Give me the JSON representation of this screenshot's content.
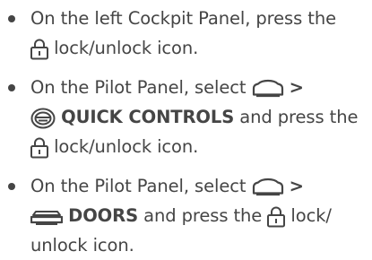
{
  "steps": [
    {
      "text_a": "On the left Cockpit Panel, press the",
      "text_b": "lock/unlock icon.",
      "icons": [
        "lock-icon"
      ]
    },
    {
      "text_a": "On the Pilot Panel, select",
      "text_b": ">",
      "text_c": "QUICK CONTROLS",
      "text_d": "and press the",
      "text_e": "lock/unlock icon.",
      "icons": [
        "car-icon",
        "steering-wheel-icon",
        "lock-icon"
      ]
    },
    {
      "text_a": "On the Pilot Panel, select",
      "text_b": ">",
      "text_c": "DOORS",
      "text_d": "and press the",
      "text_e": "lock/",
      "text_f": "unlock icon.",
      "icons": [
        "car-icon",
        "car-doors-icon",
        "lock-icon"
      ]
    }
  ]
}
